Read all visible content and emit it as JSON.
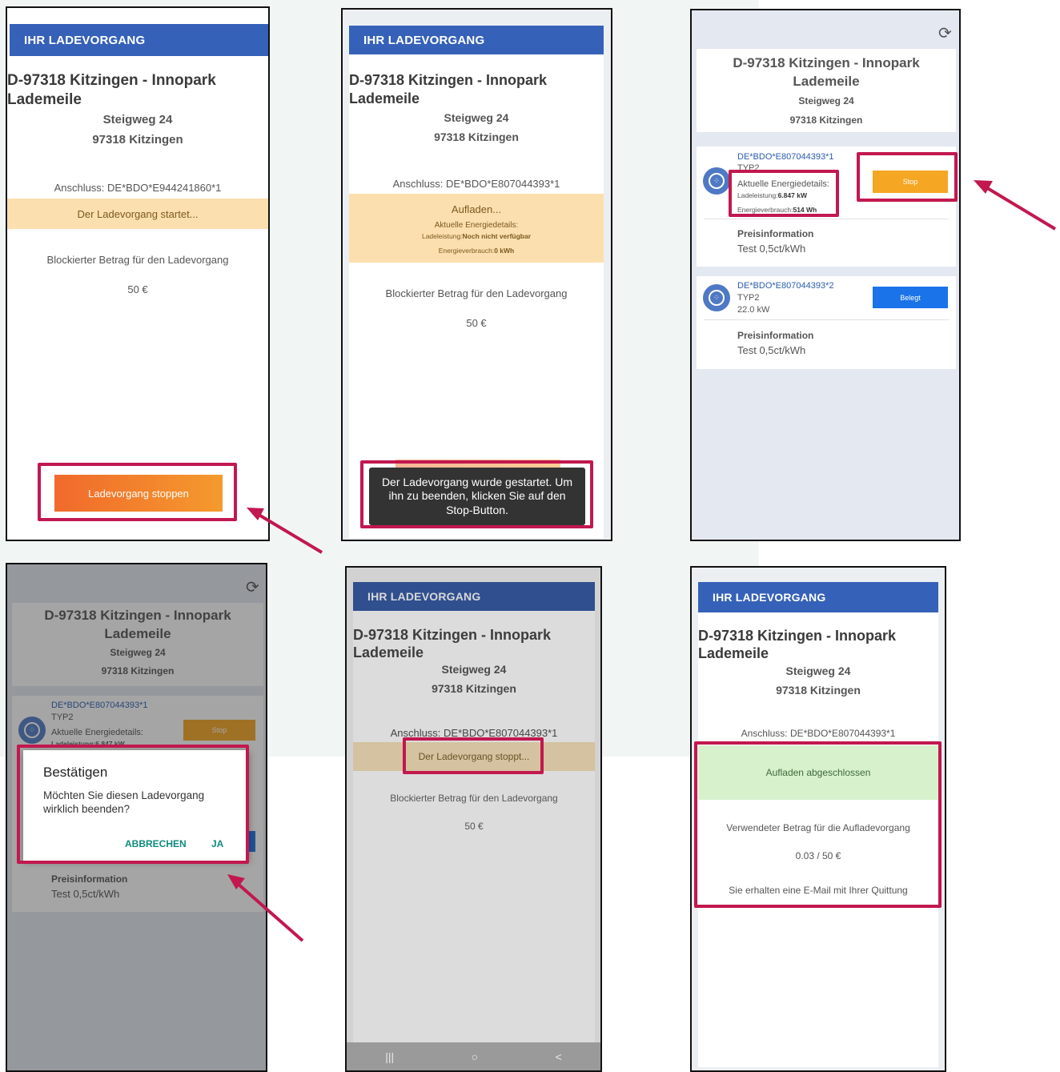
{
  "common": {
    "header": "IHR LADEVORGANG",
    "station_line1": "D-97318 Kitzingen - Innopark",
    "station_line2": "Lademeile",
    "street": "Steigweg 24",
    "city": "97318 Kitzingen",
    "blocked_label": "Blockierter Betrag für den Ladevorgang",
    "blocked_amount": "50 €",
    "price_info_label": "Preisinformation",
    "price_info_value": "Test 0,5ct/kWh"
  },
  "screen1": {
    "connection": "Anschluss: DE*BDO*E944241860*1",
    "status": "Der Ladevorgang startet...",
    "stop_button": "Ladevorgang stoppen"
  },
  "screen2": {
    "connection": "Anschluss: DE*BDO*E807044393*1",
    "status": "Aufladen...",
    "energy_title": "Aktuelle Energiedetails:",
    "power_label": "Ladeleistung:",
    "power_value": "Noch nicht verfügbar",
    "consumption_label": "Energieverbrauch:",
    "consumption_value": "0 kWh",
    "toast": "Der Ladevorgang wurde gestartet. Um ihn zu beenden, klicken Sie auf den Stop-Button."
  },
  "screen3": {
    "connector1_id": "DE*BDO*E807044393*1",
    "connector1_type": "TYP2",
    "energy_title": "Aktuelle Energiedetails:",
    "power_label": "Ladeleistung:",
    "power_value": "6.847 kW",
    "consumption_label": "Energieverbrauch:",
    "consumption_value": "514 Wh",
    "stop_button": "Stop",
    "connector2_id": "DE*BDO*E807044393*2",
    "connector2_type": "TYP2",
    "connector2_power": "22.0 kW",
    "belegt_button": "Belegt"
  },
  "screen4": {
    "connector1_id": "DE*BDO*E807044393*1",
    "connector1_type": "TYP2",
    "energy_title": "Aktuelle Energiedetails:",
    "power_partial": "Ladeleistung:6.847 kW",
    "stop_button": "Stop",
    "dialog_title": "Bestätigen",
    "dialog_message": "Möchten Sie diesen Ladevorgang wirklich beenden?",
    "dialog_cancel": "ABBRECHEN",
    "dialog_confirm": "JA"
  },
  "screen5": {
    "connection": "Anschluss: DE*BDO*E807044393*1",
    "status": "Der Ladevorgang stoppt...",
    "nav_recent": "|||",
    "nav_home": "○",
    "nav_back": "<"
  },
  "screen6": {
    "connection": "Anschluss: DE*BDO*E807044393*1",
    "status": "Aufladen abgeschlossen",
    "used_label": "Verwendeter Betrag für die Aufladevorgang",
    "used_amount": "0.03 / 50 €",
    "email_note": "Sie erhalten eine E-Mail mit Ihrer Quittung"
  },
  "colors": {
    "header_blue": "#3661b8",
    "highlight": "#c2184f",
    "status_orange": "#fcdfae",
    "status_green": "#d7f1cd",
    "stop_orange": "#f5a623",
    "belegt_blue": "#1a73e8"
  },
  "icons": {
    "refresh": "refresh-icon",
    "connector": "type2-connector-icon",
    "arrow": "annotation-arrow-icon"
  }
}
